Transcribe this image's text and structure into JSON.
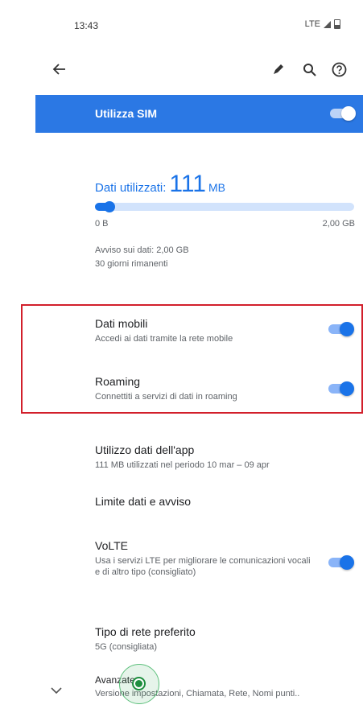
{
  "status_bar": {
    "time": "13:43",
    "network": "LTE"
  },
  "toolbar": {
    "icons": [
      "back-arrow-icon",
      "pencil-icon",
      "search-icon",
      "help-icon"
    ]
  },
  "use_sim": {
    "label": "Utilizza SIM",
    "enabled": true
  },
  "usage": {
    "label": "Dati utilizzati:",
    "amount": "111",
    "unit": "MB",
    "bar_min": "0 B",
    "bar_max": "2,00 GB",
    "progress_fraction": 0.055,
    "warning": "Avviso sui dati: 2,00 GB",
    "days_left": "30 giorni rimanenti"
  },
  "mobile_data": {
    "title": "Dati mobili",
    "subtitle": "Accedi ai dati tramite la rete mobile",
    "enabled": true
  },
  "roaming": {
    "title": "Roaming",
    "subtitle": "Connettiti a servizi di dati in roaming",
    "enabled": true
  },
  "app_usage": {
    "title": "Utilizzo dati dell'app",
    "subtitle": "111 MB utilizzati nel periodo 10 mar – 09 apr"
  },
  "data_limit": {
    "title": "Limite dati e avviso"
  },
  "volte": {
    "title": "VoLTE",
    "subtitle": "Usa i servizi LTE per migliorare le comunicazioni vocali e di altro tipo (consigliato)",
    "enabled": true
  },
  "network_type": {
    "title": "Tipo di rete preferito",
    "subtitle": "5G (consigliata)"
  },
  "advanced": {
    "title": "Avanzate",
    "subtitle": "Versione impostazioni, Chiamata, Rete, Nomi punti.."
  },
  "colors": {
    "accent": "#1a73e8",
    "header_bg": "#2b78e4",
    "highlight_border": "#d21f2b"
  }
}
